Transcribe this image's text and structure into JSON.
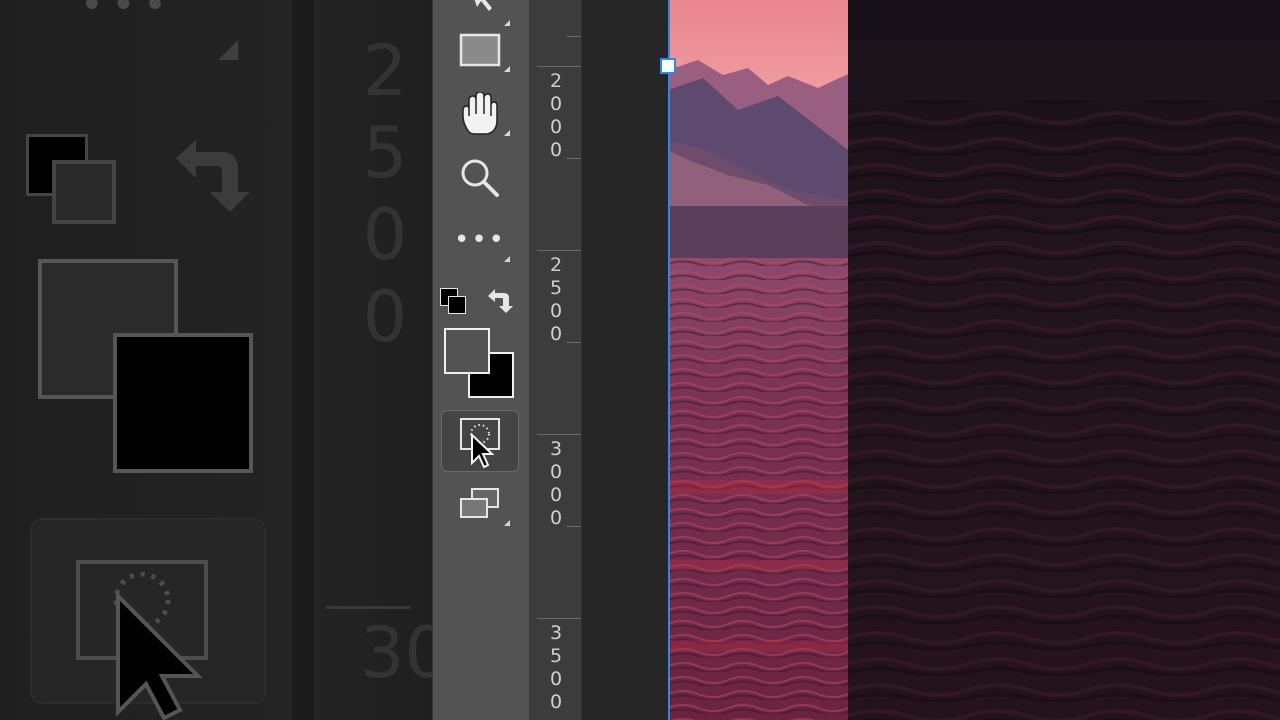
{
  "toolbar": {
    "tools": [
      {
        "name": "move-tool",
        "icon": "move-arrow-icon"
      },
      {
        "name": "rectangle-tool",
        "icon": "rectangle-shape-icon"
      },
      {
        "name": "hand-tool",
        "icon": "hand-icon"
      },
      {
        "name": "zoom-tool",
        "icon": "magnifier-icon"
      },
      {
        "name": "edit-toolbar",
        "icon": "more-dots-icon"
      },
      {
        "name": "quick-mask-mode",
        "icon": "quick-mask-icon",
        "state": "hovered"
      },
      {
        "name": "screen-mode",
        "icon": "screen-mode-icon"
      }
    ],
    "colors": {
      "foreground": "#555555",
      "background": "#000000"
    },
    "more_label": "•••"
  },
  "ruler": {
    "labels": [
      "2000",
      "2500",
      "3000",
      "3500"
    ]
  },
  "backdrop": {
    "numbers": [
      "2500",
      "30"
    ],
    "dots": "•••"
  },
  "canvas": {
    "sky_color": "#e98590",
    "water_color": "#7a2d4a",
    "selection_color": "#2e88e6"
  }
}
